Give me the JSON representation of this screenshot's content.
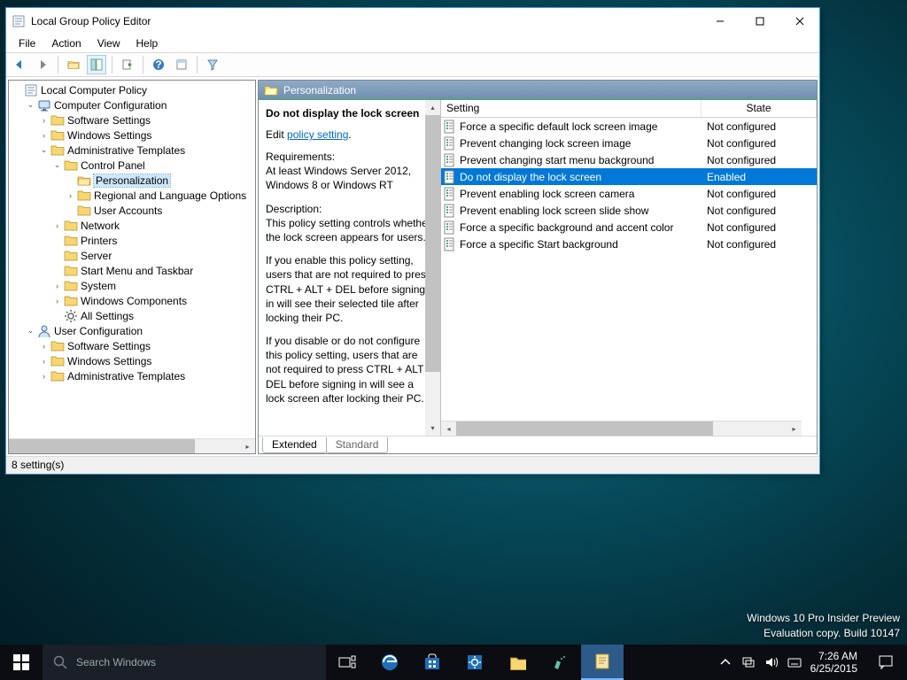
{
  "window": {
    "title": "Local Group Policy Editor",
    "menus": [
      "File",
      "Action",
      "View",
      "Help"
    ]
  },
  "tree": {
    "root": "Local Computer Policy",
    "cc": "Computer Configuration",
    "cc_items": [
      "Software Settings",
      "Windows Settings",
      "Administrative Templates"
    ],
    "cp": "Control Panel",
    "cp_items": [
      "Personalization",
      "Regional and Language Options",
      "User Accounts"
    ],
    "at_rest": [
      "Network",
      "Printers",
      "Server",
      "Start Menu and Taskbar",
      "System",
      "Windows Components",
      "All Settings"
    ],
    "uc": "User Configuration",
    "uc_items": [
      "Software Settings",
      "Windows Settings",
      "Administrative Templates"
    ]
  },
  "location": "Personalization",
  "desc": {
    "title": "Do not display the lock screen",
    "edit_prefix": "Edit ",
    "edit_link": "policy setting",
    "req_label": "Requirements:",
    "req_text": "At least Windows Server 2012, Windows 8 or Windows RT",
    "desc_label": "Description:",
    "desc_p1": "This policy setting controls whether the lock screen appears for users.",
    "desc_p2": "If you enable this policy setting, users that are not required to press CTRL + ALT + DEL before signing in will see their selected tile after locking their PC.",
    "desc_p3": "If you disable or do not configure this policy setting, users that are not required to press CTRL + ALT + DEL before signing in will see a lock screen after locking their PC."
  },
  "list": {
    "col_setting": "Setting",
    "col_state": "State",
    "rows": [
      {
        "name": "Force a specific default lock screen image",
        "state": "Not configured"
      },
      {
        "name": "Prevent changing lock screen image",
        "state": "Not configured"
      },
      {
        "name": "Prevent changing start menu background",
        "state": "Not configured"
      },
      {
        "name": "Do not display the lock screen",
        "state": "Enabled"
      },
      {
        "name": "Prevent enabling lock screen camera",
        "state": "Not configured"
      },
      {
        "name": "Prevent enabling lock screen slide show",
        "state": "Not configured"
      },
      {
        "name": "Force a specific background and accent color",
        "state": "Not configured"
      },
      {
        "name": "Force a specific Start background",
        "state": "Not configured"
      }
    ],
    "selected_index": 3
  },
  "tabs": {
    "extended": "Extended",
    "standard": "Standard"
  },
  "status": "8 setting(s)",
  "watermark": {
    "l1": "Windows 10 Pro Insider Preview",
    "l2": "Evaluation copy. Build 10147"
  },
  "taskbar": {
    "search_placeholder": "Search Windows",
    "time": "7:26 AM",
    "date": "6/25/2015"
  }
}
